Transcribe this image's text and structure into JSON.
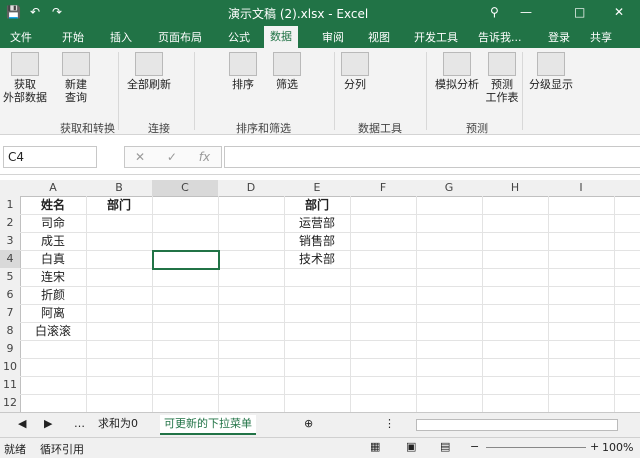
{
  "titlebar": {
    "title": "演示文稿 (2).xlsx - Excel"
  },
  "tabs": [
    "文件",
    "开始",
    "插入",
    "页面布局",
    "公式",
    "数据",
    "审阅",
    "视图",
    "开发工具"
  ],
  "active_tab": "数据",
  "tell_me": "告诉我...",
  "login": "登录",
  "share": "共享",
  "ribbon": {
    "get_external": "获取\n外部数据",
    "new_query": "新建\n查询",
    "refresh_all": "全部刷新",
    "sort": "排序",
    "filter": "筛选",
    "split": "分列",
    "whatif": "模拟分析",
    "forecast": "预测\n工作表",
    "outline": "分级显示",
    "groups": [
      "获取和转换",
      "连接",
      "排序和筛选",
      "数据工具",
      "预测"
    ]
  },
  "namebox": "C4",
  "fx": "fx",
  "columns": [
    "A",
    "B",
    "C",
    "D",
    "E",
    "F",
    "G",
    "H",
    "I"
  ],
  "rows": [
    "1",
    "2",
    "3",
    "4",
    "5",
    "6",
    "7",
    "8",
    "9",
    "10",
    "11",
    "12"
  ],
  "cells": {
    "A1": "姓名",
    "A2": "司命",
    "A3": "成玉",
    "A4": "白真",
    "A5": "连宋",
    "A6": "折颜",
    "A7": "阿离",
    "A8": "白滚滚",
    "B1": "部门",
    "E1": "部门",
    "E2": "运营部",
    "E3": "销售部",
    "E4": "技术部"
  },
  "sheets": [
    "求和为0",
    "可更新的下拉菜单"
  ],
  "active_sheet": "可更新的下拉菜单",
  "status": {
    "ready": "就绪",
    "circular": "循环引用",
    "zoom": "100%"
  }
}
